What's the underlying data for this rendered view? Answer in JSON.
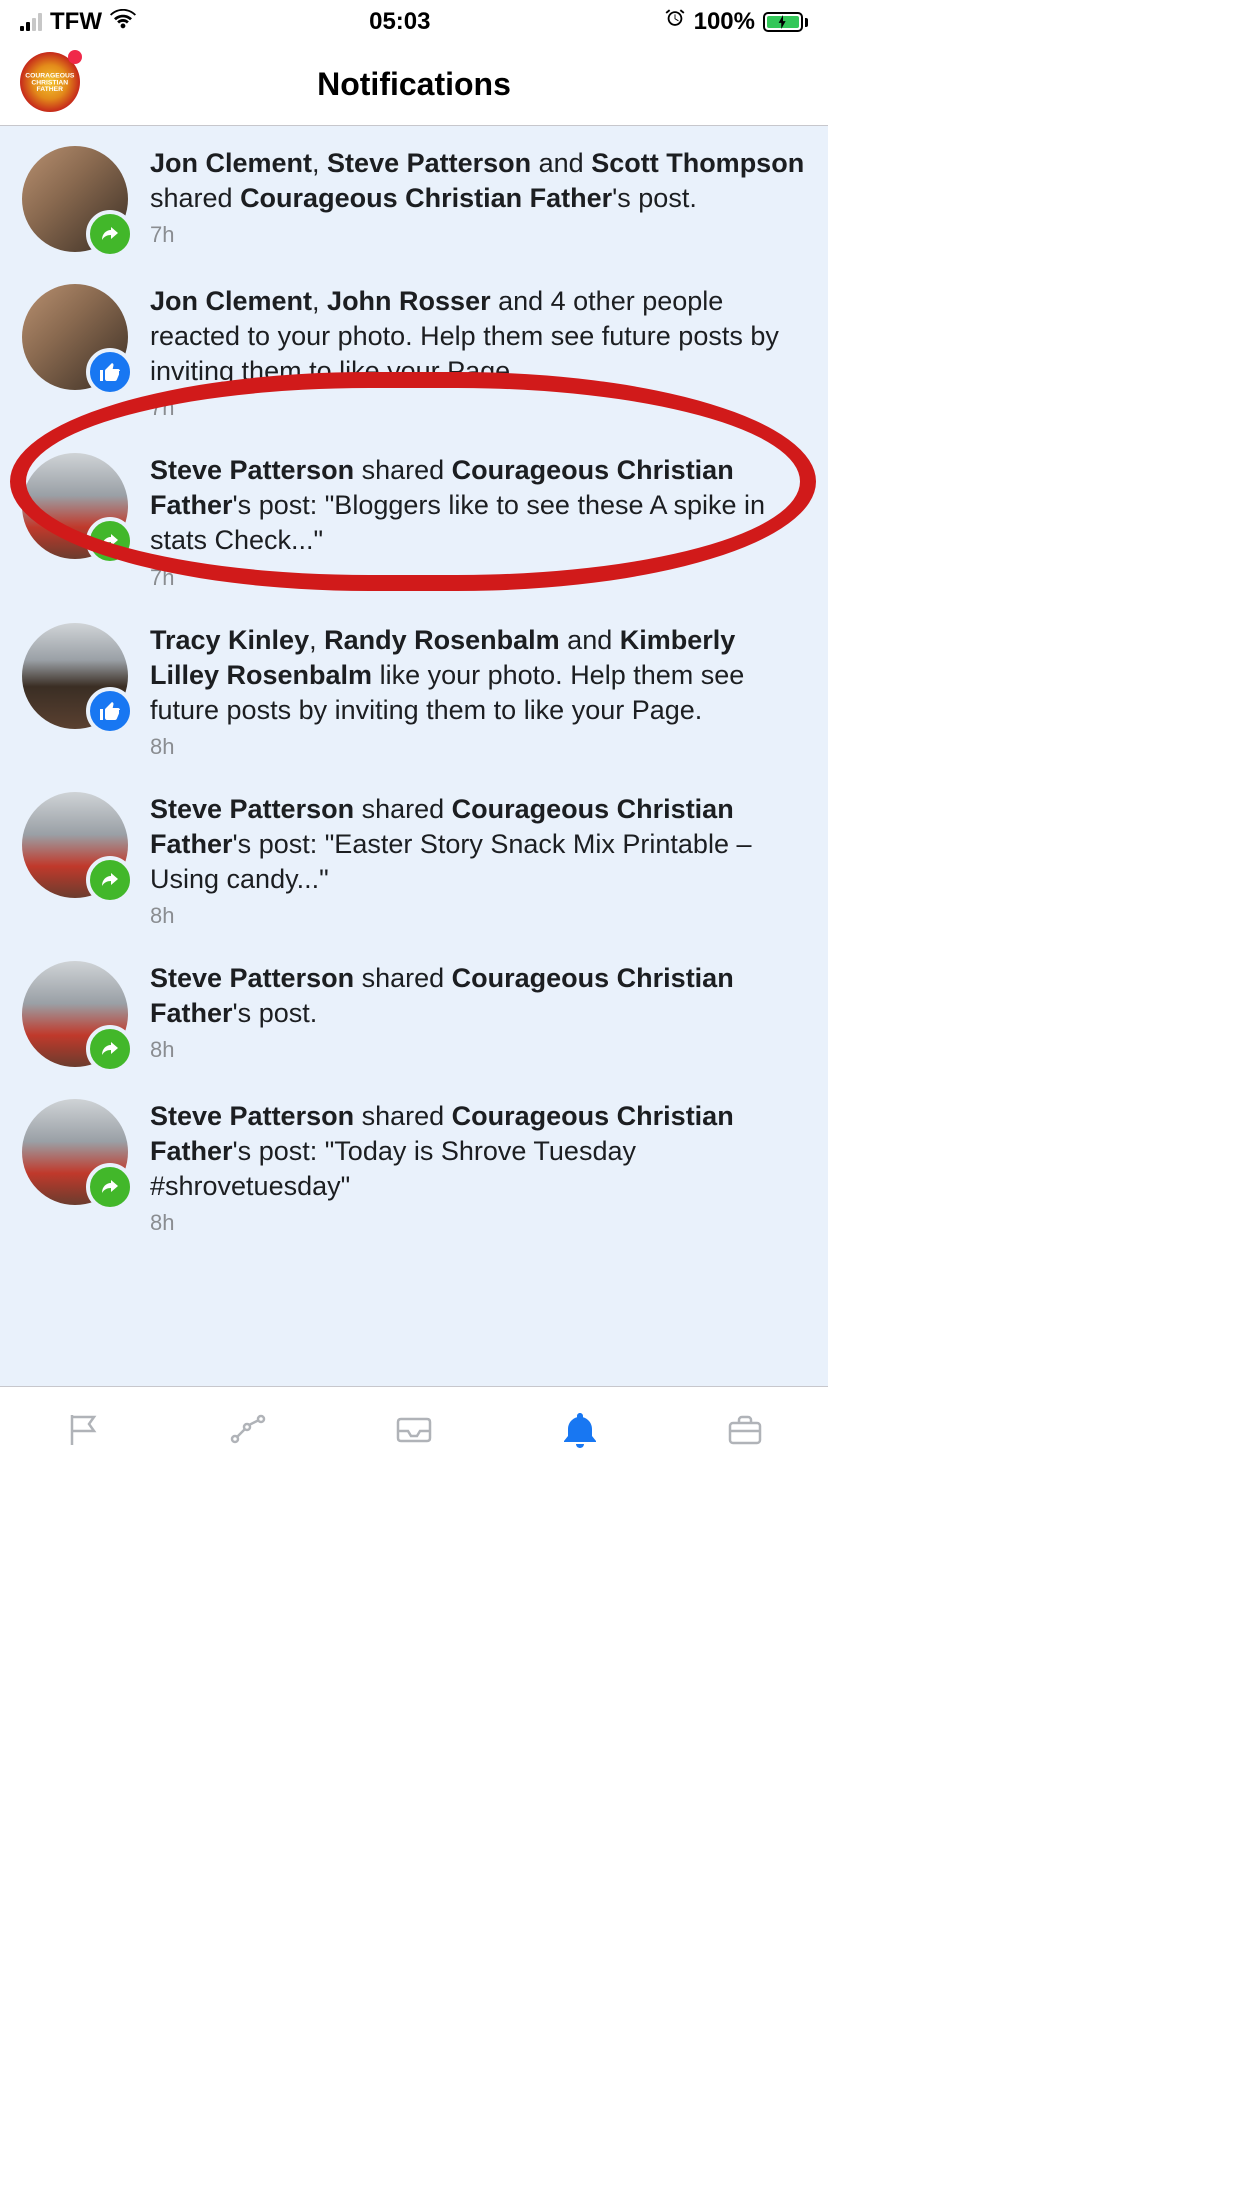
{
  "status": {
    "carrier": "TFW",
    "time": "05:03",
    "battery_pct": "100%"
  },
  "header": {
    "title": "Notifications",
    "logo_text": "COURAGEOUS CHRISTIAN FATHER"
  },
  "notifications": [
    {
      "segments": [
        {
          "t": "Jon Clement",
          "b": true
        },
        {
          "t": ", ",
          "b": false
        },
        {
          "t": "Steve Patterson",
          "b": true
        },
        {
          "t": " and ",
          "b": false
        },
        {
          "t": "Scott Thompson",
          "b": true
        },
        {
          "t": " shared ",
          "b": false
        },
        {
          "t": "Courageous Christian Father",
          "b": true
        },
        {
          "t": "'s post.",
          "b": false
        }
      ],
      "time": "7h",
      "badge": "share",
      "avatar_class": ""
    },
    {
      "segments": [
        {
          "t": "Jon Clement",
          "b": true
        },
        {
          "t": ", ",
          "b": false
        },
        {
          "t": "John Rosser",
          "b": true
        },
        {
          "t": " and 4 other people reacted to your photo. Help them see future posts by inviting them to like your Page.",
          "b": false
        }
      ],
      "time": "7h",
      "badge": "like",
      "avatar_class": "",
      "clamp": true,
      "highlighted": true
    },
    {
      "segments": [
        {
          "t": "Steve Patterson",
          "b": true
        },
        {
          "t": " shared ",
          "b": false
        },
        {
          "t": "Courageous Christian Father",
          "b": true
        },
        {
          "t": "'s post: \"Bloggers like to see these A spike in stats Check...\"",
          "b": false
        }
      ],
      "time": "7h",
      "badge": "share",
      "avatar_class": "avatar-steve"
    },
    {
      "segments": [
        {
          "t": "Tracy Kinley",
          "b": true
        },
        {
          "t": ", ",
          "b": false
        },
        {
          "t": "Randy Rosenbalm",
          "b": true
        },
        {
          "t": " and ",
          "b": false
        },
        {
          "t": "Kimberly Lilley Rosenbalm",
          "b": true
        },
        {
          "t": " like your photo. Help them see future posts by inviting them to like your Page.",
          "b": false
        }
      ],
      "time": "8h",
      "badge": "like",
      "avatar_class": "avatar-tracy",
      "clamp": true
    },
    {
      "segments": [
        {
          "t": "Steve Patterson",
          "b": true
        },
        {
          "t": " shared ",
          "b": false
        },
        {
          "t": "Courageous Christian Father",
          "b": true
        },
        {
          "t": "'s post: \"Easter Story Snack Mix Printable – Using candy...\"",
          "b": false
        }
      ],
      "time": "8h",
      "badge": "share",
      "avatar_class": "avatar-steve"
    },
    {
      "segments": [
        {
          "t": "Steve Patterson",
          "b": true
        },
        {
          "t": " shared ",
          "b": false
        },
        {
          "t": "Courageous Christian Father",
          "b": true
        },
        {
          "t": "'s post.",
          "b": false
        }
      ],
      "time": "8h",
      "badge": "share",
      "avatar_class": "avatar-steve"
    },
    {
      "segments": [
        {
          "t": "Steve Patterson",
          "b": true
        },
        {
          "t": " shared ",
          "b": false
        },
        {
          "t": "Courageous Christian Father",
          "b": true
        },
        {
          "t": "'s post: \"Today is Shrove Tuesday #shrovetuesday\"",
          "b": false
        }
      ],
      "time": "8h",
      "badge": "share",
      "avatar_class": "avatar-steve",
      "partial": true
    }
  ]
}
